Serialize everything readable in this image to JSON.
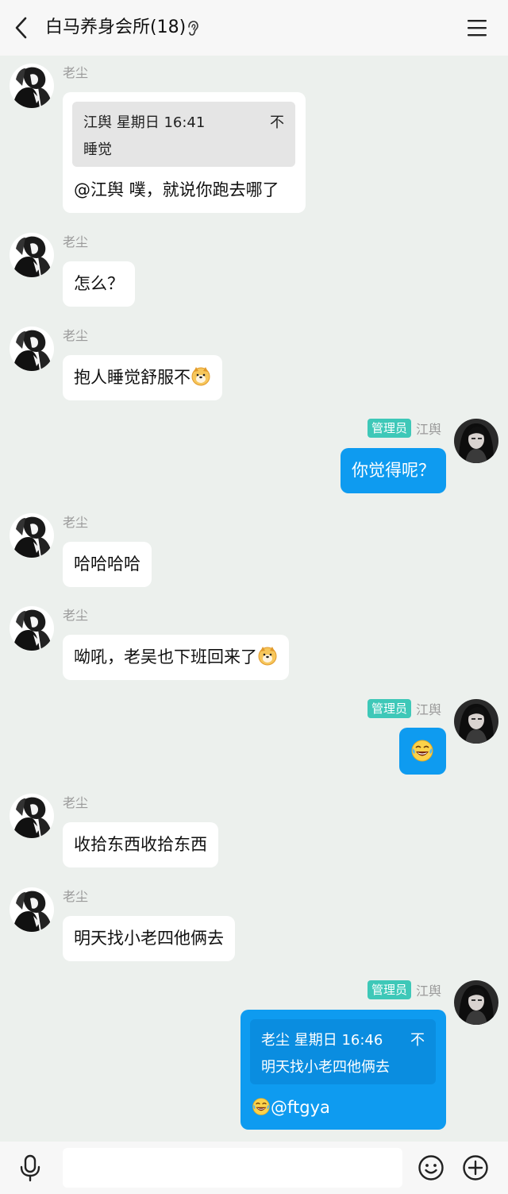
{
  "header": {
    "title": "白马养身会所(18)"
  },
  "messages": [
    {
      "sender": "老尘",
      "quote": {
        "from": "江舆",
        "time": "星期日 16:41",
        "text": "睡觉",
        "action": "不"
      },
      "text": "@江舆 噗，就说你跑去哪了"
    },
    {
      "sender": "老尘",
      "text": "怎么？"
    },
    {
      "sender": "老尘",
      "text": "抱人睡觉舒服不"
    },
    {
      "sender": "江舆",
      "badge": "管理员",
      "text": "你觉得呢？"
    },
    {
      "sender": "老尘",
      "text": "哈哈哈哈"
    },
    {
      "sender": "老尘",
      "text": "呦吼，老吴也下班回来了"
    },
    {
      "sender": "江舆",
      "badge": "管理员",
      "text": ""
    },
    {
      "sender": "老尘",
      "text": "收拾东西收拾东西"
    },
    {
      "sender": "老尘",
      "text": "明天找小老四他俩去"
    },
    {
      "sender": "江舆",
      "badge": "管理员",
      "quote": {
        "from": "老尘",
        "time": "星期日 16:46",
        "text": "明天找小老四他俩去",
        "action": "不"
      },
      "text": "@ftgya"
    }
  ],
  "colors": {
    "my_bubble": "#0e9bf0",
    "badge": "#3ec8b8",
    "background": "#ecf0ed"
  },
  "icons": [
    "back-icon",
    "ear-icon",
    "menu-icon",
    "doge-emoji",
    "laughing-tears-emoji",
    "microphone-icon",
    "smiley-icon",
    "plus-circle-icon"
  ]
}
